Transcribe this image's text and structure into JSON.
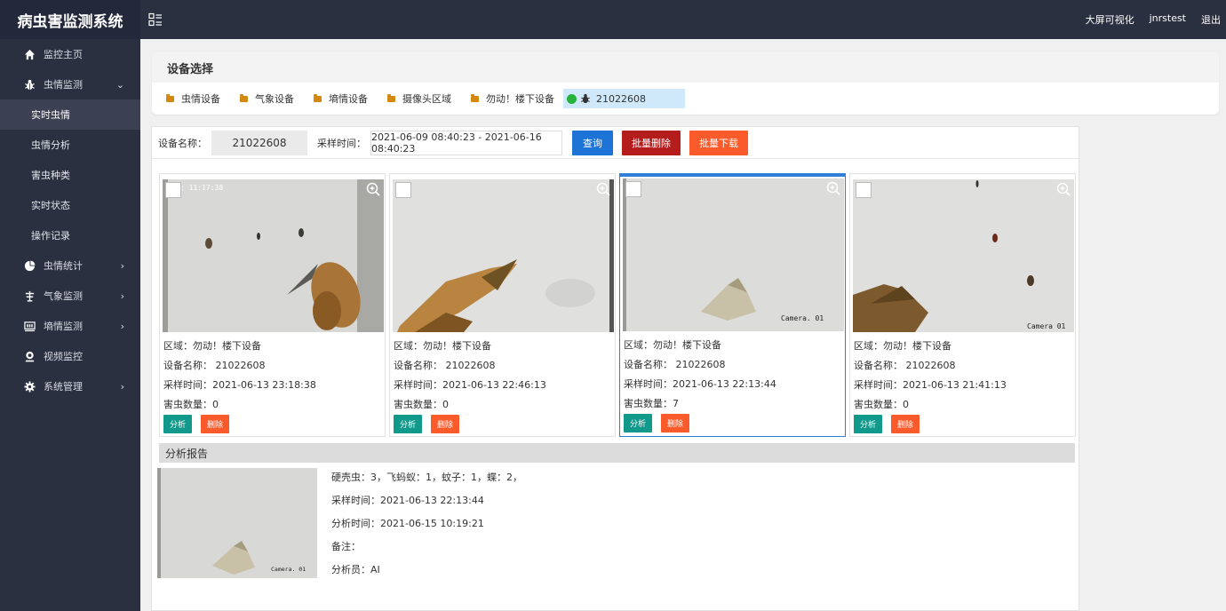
{
  "app": {
    "title": "病虫害监测系统"
  },
  "topbar": {
    "links": [
      "大屏可视化",
      "jnrstest",
      "退出"
    ]
  },
  "sidebar": {
    "items": [
      {
        "icon": "home-icon",
        "label": "监控主页",
        "arrow": ""
      },
      {
        "icon": "bug-icon",
        "label": "虫情监测",
        "arrow": "⌄"
      },
      {
        "icon": "pie-chart-icon",
        "label": "虫情统计",
        "arrow": "›"
      },
      {
        "icon": "weather-station-icon",
        "label": "气象监测",
        "arrow": "›"
      },
      {
        "icon": "soil-monitor-icon",
        "label": "墒情监测",
        "arrow": "›"
      },
      {
        "icon": "camera-icon",
        "label": "视频监控",
        "arrow": ""
      },
      {
        "icon": "gear-icon",
        "label": "系统管理",
        "arrow": "›"
      }
    ],
    "sub_items": [
      "实时虫情",
      "虫情分析",
      "害虫种类",
      "实时状态",
      "操作记录"
    ],
    "active_sub": "实时虫情"
  },
  "device_select": {
    "title": "设备选择",
    "tabs": [
      "虫情设备",
      "气象设备",
      "墒情设备",
      "摄像头区域",
      "勿动！楼下设备"
    ],
    "selected_device": "21022608"
  },
  "filter": {
    "name_label": "设备名称：",
    "name_value": "21022608",
    "time_label": "采样时间：",
    "time_range": "2021-06-09 08:40:23 - 2021-06-16 08:40:23",
    "query_btn": "查询",
    "batch_delete_btn": "批量删除",
    "batch_download_btn": "批量下载"
  },
  "colors": {
    "sidebar_bg": "#2b3041",
    "query_blue": "#1e73d6",
    "batch_delete_red": "#b51d1d",
    "batch_download_orange": "#fb5a2a",
    "analyze_teal": "#119a8c",
    "delete_orange": "#fb5a2a",
    "active_blue": "#2f7fd6"
  },
  "cards": [
    {
      "overlay": ": 11:17:38",
      "area": "区域：勿动！楼下设备",
      "device": "设备名称： 21022608",
      "time": "采样时间：2021-06-13 23:18:38",
      "count": "害虫数量：0",
      "analyze": "分析",
      "delete": "删除"
    },
    {
      "overlay": "",
      "area": "区域：勿动！楼下设备",
      "device": "设备名称： 21022608",
      "time": "采样时间：2021-06-13 22:46:13",
      "count": "害虫数量：0",
      "analyze": "分析",
      "delete": "删除"
    },
    {
      "overlay": "Camera. 01",
      "area": "区域：勿动！楼下设备",
      "device": "设备名称： 21022608",
      "time": "采样时间：2021-06-13 22:13:44",
      "count": "害虫数量：7",
      "analyze": "分析",
      "delete": "删除"
    },
    {
      "overlay": "Camera 01",
      "area": "区域：勿动！楼下设备",
      "device": "设备名称： 21022608",
      "time": "采样时间：2021-06-13 21:41:13",
      "count": "害虫数量：0",
      "analyze": "分析",
      "delete": "删除"
    }
  ],
  "report": {
    "title": "分析报告",
    "photo_overlay": "Camera. 01",
    "lines": [
      "硬壳虫：3，飞蚂蚁：1，蚊子：1，蝶：2，",
      "采样时间：2021-06-13 22:13:44",
      "分析时间：2021-06-15 10:19:21",
      "备注：",
      "分析员：AI"
    ]
  }
}
